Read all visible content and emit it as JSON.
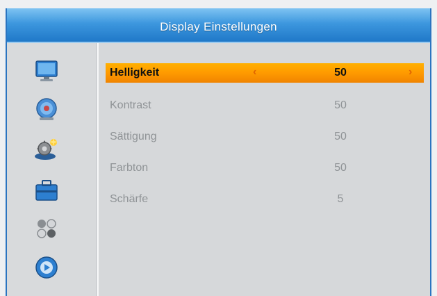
{
  "window": {
    "title": "Display Einstellungen"
  },
  "sidebar": {
    "items": [
      {
        "icon": "tv-monitor-icon"
      },
      {
        "icon": "satellite-dish-icon"
      },
      {
        "icon": "settings-gear-icon"
      },
      {
        "icon": "toolbox-icon"
      },
      {
        "icon": "games-icon"
      },
      {
        "icon": "media-disc-icon"
      }
    ],
    "selected_index": 2
  },
  "settings": {
    "selected_index": 0,
    "items": [
      {
        "label": "Helligkeit",
        "value": "50"
      },
      {
        "label": "Kontrast",
        "value": "50"
      },
      {
        "label": "Sättigung",
        "value": "50"
      },
      {
        "label": "Farbton",
        "value": "50"
      },
      {
        "label": "Schärfe",
        "value": "5"
      }
    ],
    "arrows": {
      "left": "‹",
      "right": "›"
    }
  },
  "colors": {
    "title_bar": "#2a86d6",
    "highlight": "#ff9a00",
    "text_inactive": "#8f9396",
    "background": "#d6d8da"
  }
}
